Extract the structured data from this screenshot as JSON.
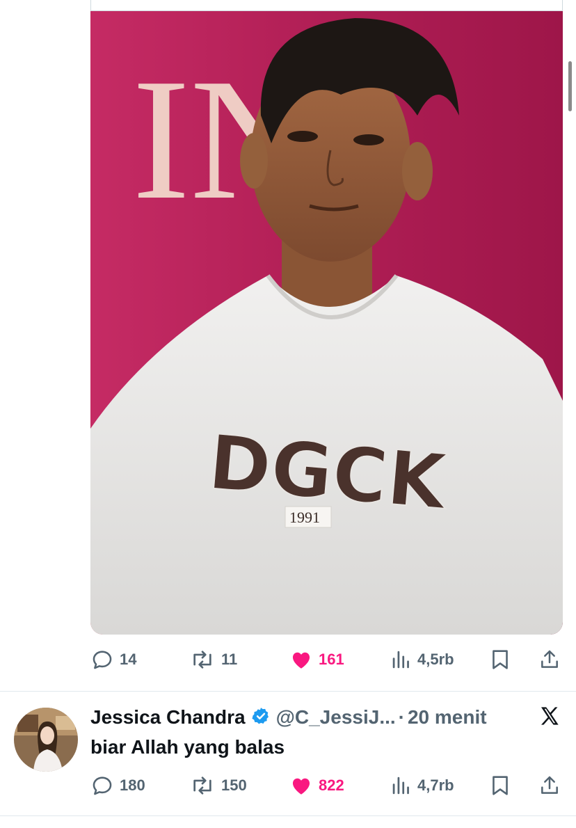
{
  "post1": {
    "photo": {
      "description": "photo-of-man",
      "shirt_text": "DGCK",
      "shirt_year": "1991",
      "poster_letters": "IN"
    },
    "actions": {
      "replies": "14",
      "reposts": "11",
      "likes": "161",
      "views": "4,5rb"
    }
  },
  "post2": {
    "author_name": "Jessica Chandra",
    "author_handle": "@C_JessiJ...",
    "separator": "·",
    "time": "20 menit",
    "text": "biar Allah yang balas",
    "actions": {
      "replies": "180",
      "reposts": "150",
      "likes": "822",
      "views": "4,7rb"
    }
  },
  "colors": {
    "like": "#f91880",
    "muted": "#536471",
    "verified": "#1d9bf0",
    "text": "#0f1419"
  },
  "icons": [
    "reply-icon",
    "repost-icon",
    "heart-icon",
    "views-icon",
    "bookmark-icon",
    "share-icon",
    "verified-badge-icon",
    "x-logo-icon"
  ]
}
